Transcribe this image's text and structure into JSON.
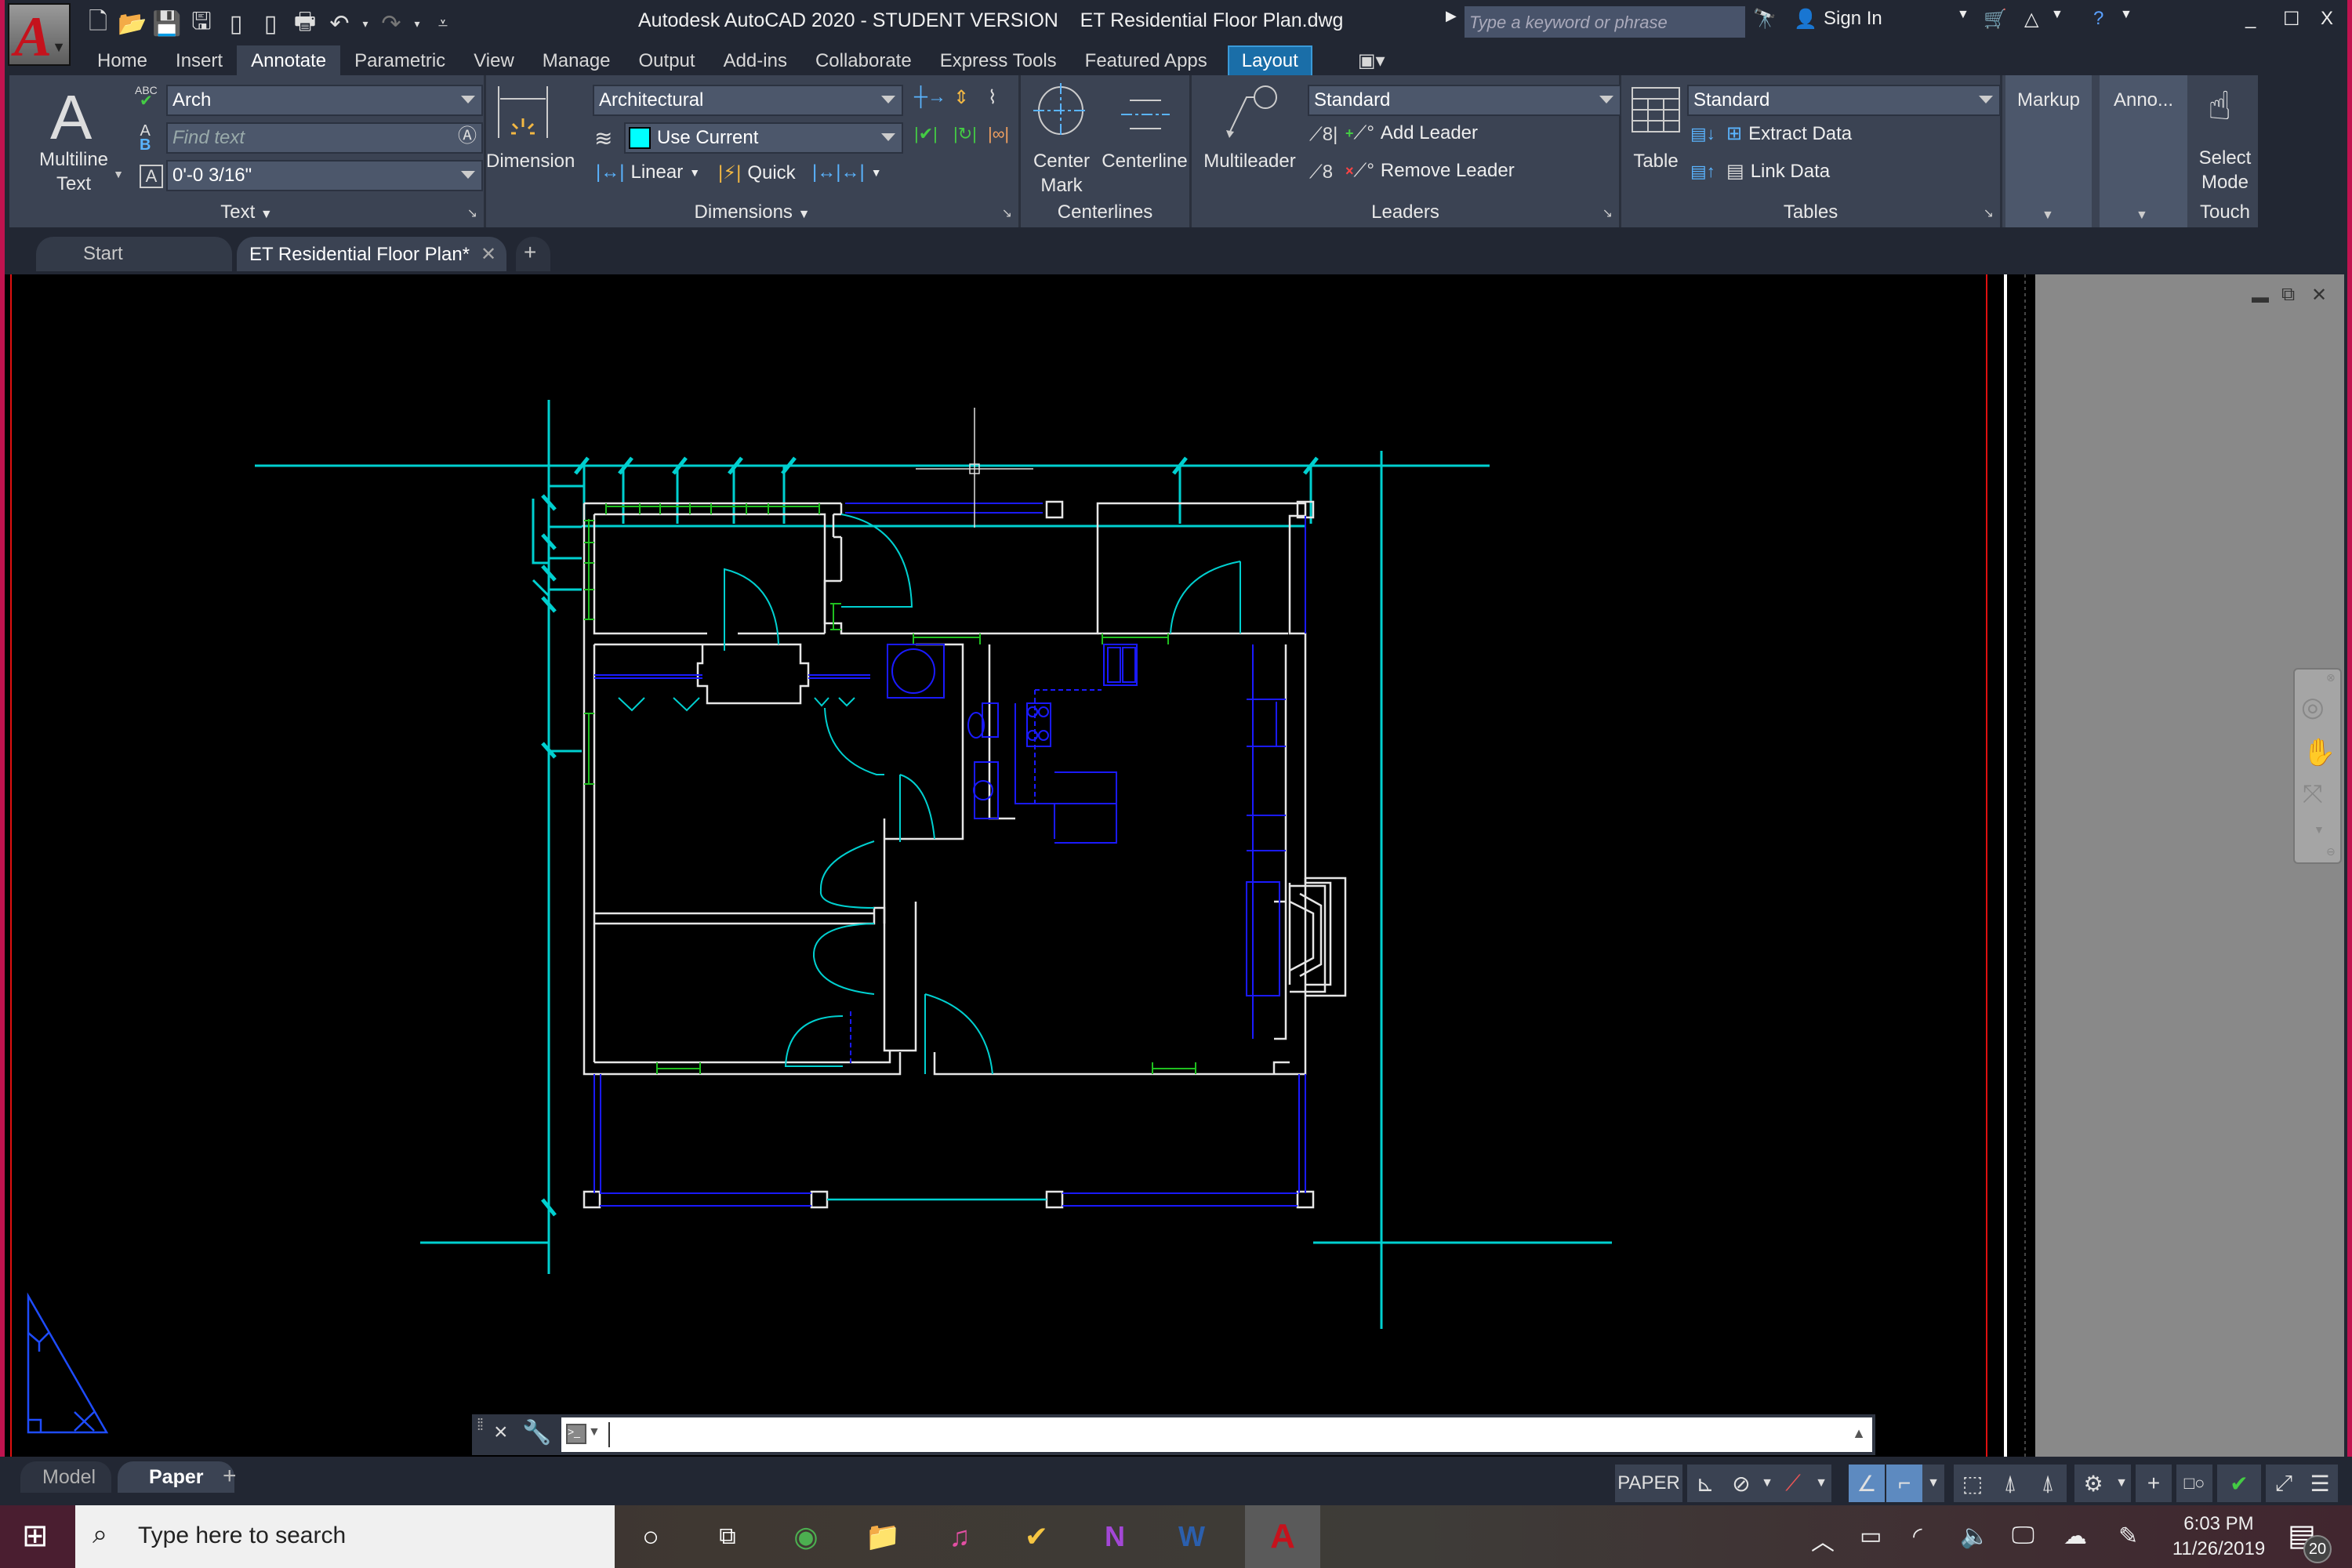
{
  "window": {
    "title": "Autodesk AutoCAD 2020 - STUDENT VERSION    ET Residential Floor Plan.dwg",
    "search_placeholder": "Type a keyword or phrase",
    "sign_in": "Sign In"
  },
  "quick_access": [
    "new-icon",
    "open-icon",
    "save-icon",
    "save-as-icon",
    "open-from-mobile-icon",
    "save-to-mobile-icon",
    "plot-icon",
    "undo-icon",
    "redo-icon",
    "customize-icon"
  ],
  "ribbon_tabs": [
    "Home",
    "Insert",
    "Annotate",
    "Parametric",
    "View",
    "Manage",
    "Output",
    "Add-ins",
    "Collaborate",
    "Express Tools",
    "Featured Apps",
    "Layout"
  ],
  "active_ribbon_tab": "Annotate",
  "ribbon": {
    "text_panel": {
      "title": "Text",
      "multiline_text": "Multiline\nText",
      "text_style": "Arch",
      "find_text_placeholder": "Find text",
      "text_height": "0'-0 3/16\""
    },
    "dimensions_panel": {
      "title": "Dimensions",
      "dimension": "Dimension",
      "dim_style": "Architectural",
      "dim_layer": "Use Current",
      "dim_layer_color": "#00ffff",
      "linear": "Linear",
      "quick": "Quick"
    },
    "centerlines_panel": {
      "title": "Centerlines",
      "center_mark": "Center\nMark",
      "centerline": "Centerline"
    },
    "leaders_panel": {
      "title": "Leaders",
      "multileader": "Multileader",
      "mleader_style": "Standard",
      "add_leader": "Add Leader",
      "remove_leader": "Remove Leader"
    },
    "tables_panel": {
      "title": "Tables",
      "table": "Table",
      "table_style": "Standard",
      "extract_data": "Extract Data",
      "link_data": "Link Data"
    },
    "markup": "Markup",
    "annotation_scaling": "Anno...",
    "touch_panel": {
      "title": "Touch",
      "select_mode": "Select\nMode"
    }
  },
  "doc_tabs": [
    {
      "label": "Start"
    },
    {
      "label": "ET Residential Floor Plan*"
    }
  ],
  "layout_tabs": [
    "Model",
    "Paper"
  ],
  "active_layout_tab": "Paper",
  "status": {
    "space": "PAPER"
  },
  "taskbar": {
    "search_placeholder": "Type here to search",
    "time": "6:03 PM",
    "date": "11/26/2019",
    "notifications": "20"
  },
  "colors": {
    "accent_layout_tab": "#1a6ea8",
    "wall": "#e6e6e6",
    "dimension": "#00d8d8",
    "fixture": "#1a1aff",
    "window_glass": "#1fbf1f",
    "viewport_border": "#e01010"
  }
}
